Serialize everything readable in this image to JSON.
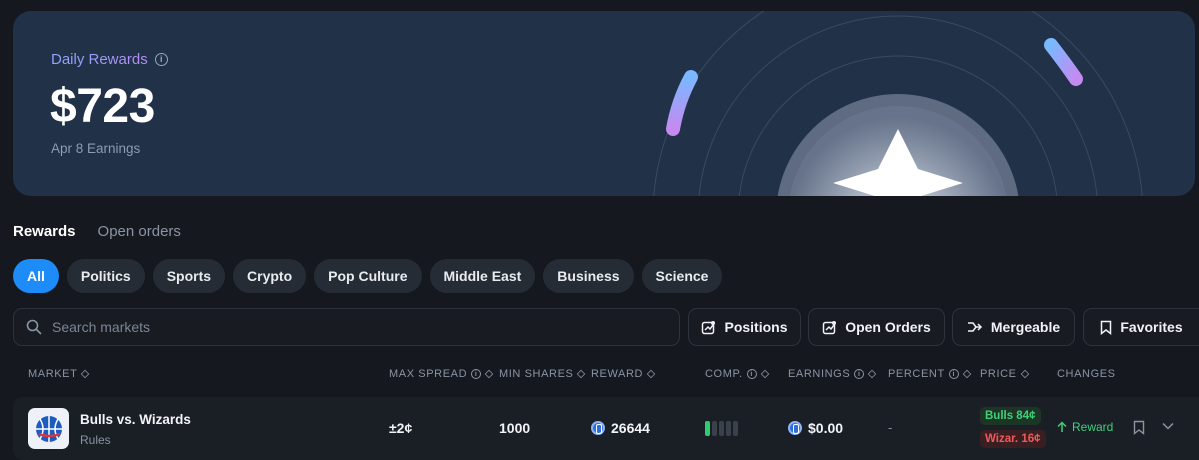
{
  "hero": {
    "title": "Daily Rewards",
    "value": "$723",
    "subtitle": "Apr 8 Earnings"
  },
  "tabs": [
    {
      "label": "Rewards",
      "active": true
    },
    {
      "label": "Open orders",
      "active": false
    }
  ],
  "categories": [
    "All",
    "Politics",
    "Sports",
    "Crypto",
    "Pop Culture",
    "Middle East",
    "Business",
    "Science"
  ],
  "active_category": "All",
  "search": {
    "placeholder": "Search markets"
  },
  "actions": {
    "positions": "Positions",
    "open_orders": "Open Orders",
    "mergeable": "Mergeable",
    "favorites": "Favorites"
  },
  "table": {
    "headers": {
      "market": "MARKET",
      "max_spread": "MAX SPREAD",
      "min_shares": "MIN SHARES",
      "reward": "REWARD",
      "comp": "COMP.",
      "earnings": "EARNINGS",
      "percent": "PERCENT",
      "price": "PRICE",
      "changes": "CHANGES"
    },
    "rows": [
      {
        "title": "Bulls vs. Wizards",
        "subtitle": "Rules",
        "max_spread": "±2¢",
        "min_shares": "1000",
        "reward": "26644",
        "competition_level": 1,
        "competition_max": 5,
        "earnings": "$0.00",
        "percent": "-",
        "price_yes": "Bulls 84¢",
        "price_no": "Wizar. 16¢",
        "change": "Reward"
      }
    ]
  },
  "colors": {
    "accent": "#1d8cf8",
    "hero_bg": "#213148",
    "positive": "#3ed07a",
    "negative": "#ef5b5b"
  }
}
